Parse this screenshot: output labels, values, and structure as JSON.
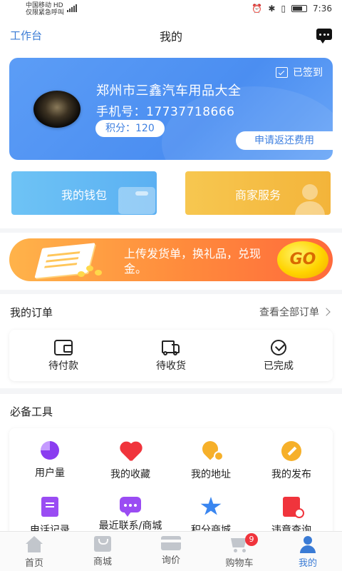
{
  "status_bar": {
    "carrier_line1": "中国移动 HD",
    "carrier_line2": "仅限紧急呼叫",
    "time": "7:36"
  },
  "header": {
    "left_link": "工作台",
    "title": "我的",
    "right_icon": "message-icon"
  },
  "profile": {
    "shop_name": "郑州市三鑫汽车用品大全",
    "phone_label": "手机号：17737718666",
    "points_label": "积分：120",
    "signed_label": "已签到",
    "refund_button": "申请返还费用",
    "card_color": "#4b8ef1"
  },
  "quick_actions": {
    "wallet": "我的钱包",
    "merchant": "商家服务"
  },
  "promo": {
    "text": "上传发货单，换礼品，兑现金。",
    "go_label": "GO"
  },
  "orders": {
    "title": "我的订单",
    "view_all": "查看全部订单",
    "items": [
      {
        "label": "待付款",
        "icon": "wallet-icon"
      },
      {
        "label": "待收货",
        "icon": "truck-icon"
      },
      {
        "label": "已完成",
        "icon": "check-circle-icon"
      }
    ]
  },
  "tools": {
    "title": "必备工具",
    "items": [
      {
        "label": "用户量",
        "icon": "pie-chart-icon"
      },
      {
        "label": "我的收藏",
        "icon": "heart-icon"
      },
      {
        "label": "我的地址",
        "icon": "location-pin-icon"
      },
      {
        "label": "我的发布",
        "icon": "pen-icon"
      },
      {
        "label": "电话记录",
        "icon": "phone-record-icon"
      },
      {
        "label": "最近联系/商城",
        "icon": "chat-icon"
      },
      {
        "label": "积分商城",
        "icon": "star-icon"
      },
      {
        "label": "违章查询",
        "icon": "document-search-icon"
      }
    ]
  },
  "tabbar": {
    "items": [
      {
        "label": "首页",
        "icon": "home-icon"
      },
      {
        "label": "商城",
        "icon": "shop-icon"
      },
      {
        "label": "询价",
        "icon": "card-icon"
      },
      {
        "label": "购物车",
        "icon": "cart-icon",
        "badge": "9"
      },
      {
        "label": "我的",
        "icon": "user-icon",
        "active": true
      }
    ],
    "active_color": "#3a7bd5"
  }
}
